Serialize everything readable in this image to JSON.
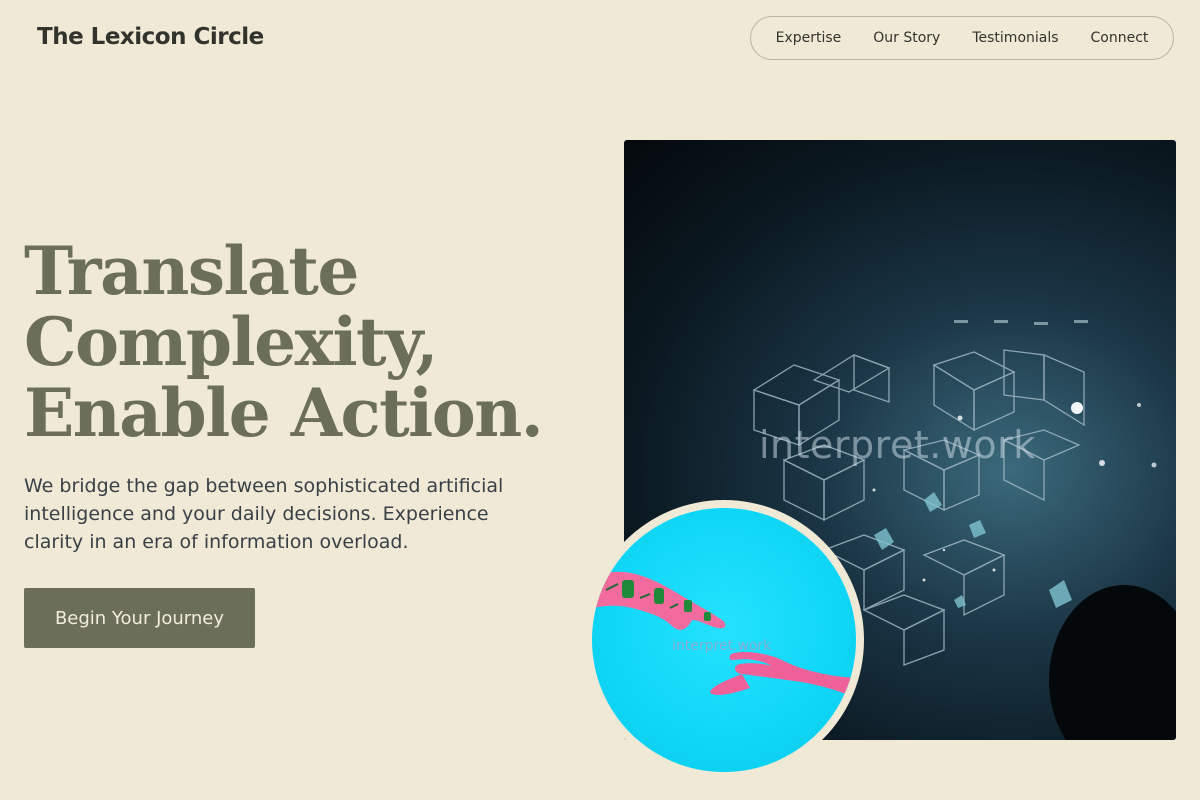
{
  "brand": {
    "name": "The Lexicon Circle"
  },
  "nav": {
    "items": [
      {
        "label": "Expertise"
      },
      {
        "label": "Our Story"
      },
      {
        "label": "Testimonials"
      },
      {
        "label": "Connect"
      }
    ]
  },
  "hero": {
    "title_lines": [
      "Translate",
      "Complexity,",
      "Enable Action."
    ],
    "subtitle": "We bridge the gap between sophisticated artificial intelligence and your daily decisions. Experience clarity in an era of information overload.",
    "cta_label": "Begin Your Journey"
  },
  "images": {
    "main_watermark": "interpret.work",
    "circle_watermark": "interpret.work"
  },
  "colors": {
    "background": "#efe9d6",
    "accent": "#6b6e58",
    "text": "#33332e"
  }
}
